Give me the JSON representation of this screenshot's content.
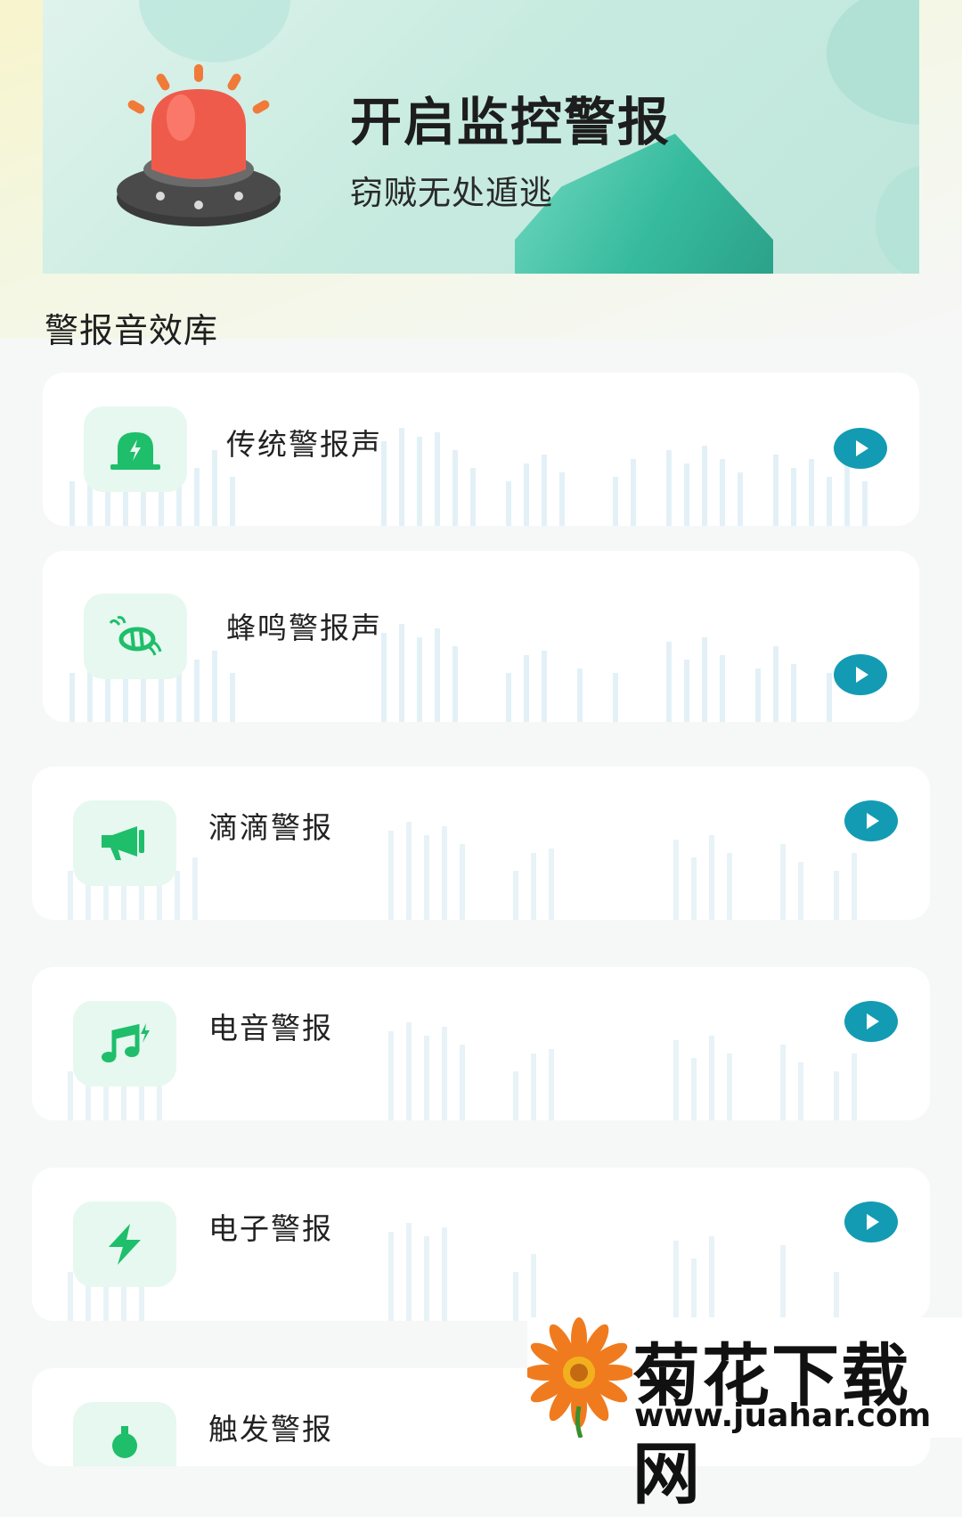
{
  "banner": {
    "title": "开启监控警报",
    "subtitle": "窃贼无处遁逃"
  },
  "section": {
    "title": "警报音效库"
  },
  "sounds": [
    {
      "label": "传统警报声",
      "icon": "siren-icon"
    },
    {
      "label": "蜂鸣警报声",
      "icon": "bee-icon"
    },
    {
      "label": "滴滴警报",
      "icon": "megaphone-icon"
    },
    {
      "label": "电音警报",
      "icon": "music-note-icon"
    },
    {
      "label": "电子警报",
      "icon": "lightning-icon"
    },
    {
      "label": "触发警报",
      "icon": "trigger-icon"
    }
  ],
  "watermark": {
    "title": "菊花下载网",
    "url": "www.juahar.com"
  },
  "colors": {
    "accent": "#139bb3",
    "icon_green": "#1ebe6b",
    "icon_bg": "#e6f8ef"
  }
}
